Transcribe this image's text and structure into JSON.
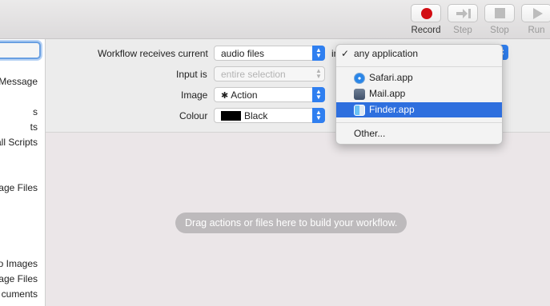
{
  "toolbar": {
    "buttons": [
      {
        "label": "Record",
        "icon": "record-icon",
        "enabled": true
      },
      {
        "label": "Step",
        "icon": "step-icon",
        "enabled": false
      },
      {
        "label": "Stop",
        "icon": "stop-icon",
        "enabled": false
      },
      {
        "label": "Run",
        "icon": "run-icon",
        "enabled": false
      }
    ]
  },
  "sidebar": {
    "items": [
      "Message",
      "s",
      "ts",
      "all Scripts",
      "age Files",
      "o Images",
      "mage Files",
      "cuments"
    ]
  },
  "panel": {
    "receives_label": "Workflow receives current",
    "receives_value": "audio files",
    "in_label": "in",
    "input_label": "Input is",
    "input_placeholder": "entire selection",
    "image_label": "Image",
    "image_value": "Action",
    "colour_label": "Colour",
    "colour_value": "Black",
    "colour_swatch": "#000000"
  },
  "menu": {
    "checked": "any application",
    "apps": [
      {
        "label": "Safari.app",
        "icon": "safari-icon"
      },
      {
        "label": "Mail.app",
        "icon": "mail-icon"
      },
      {
        "label": "Finder.app",
        "icon": "finder-icon",
        "selected": true
      }
    ],
    "other": "Other..."
  },
  "workflow": {
    "hint": "Drag actions or files here to build your workflow."
  },
  "colors": {
    "accent": "#2f7ff0",
    "selection": "#2e6fde",
    "record": "#d20d13"
  }
}
